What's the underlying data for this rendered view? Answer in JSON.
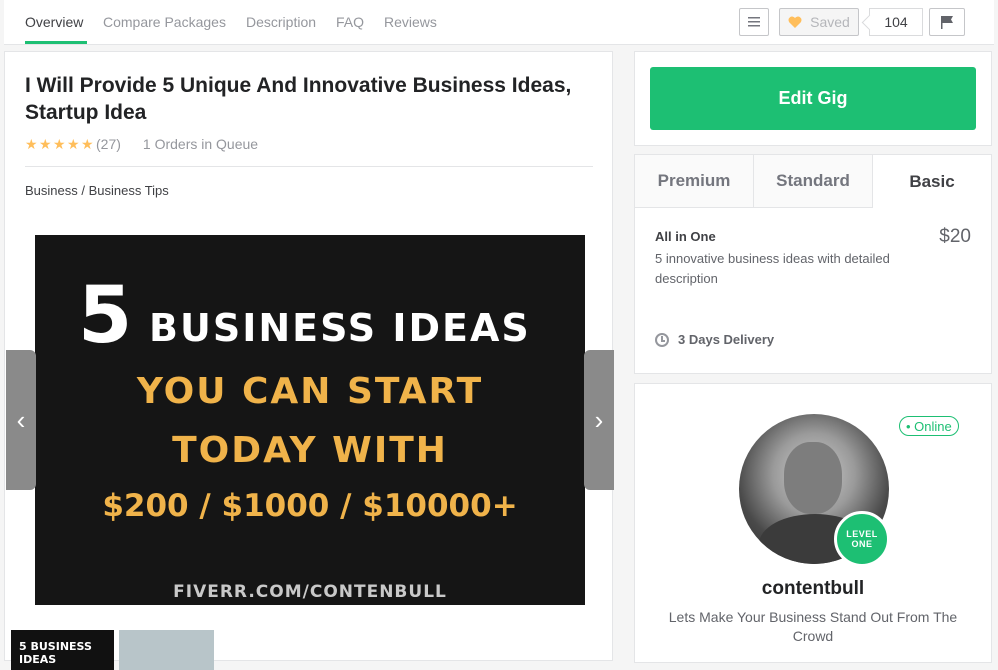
{
  "nav": {
    "tabs": [
      {
        "label": "Overview"
      },
      {
        "label": "Compare Packages"
      },
      {
        "label": "Description"
      },
      {
        "label": "FAQ"
      },
      {
        "label": "Reviews"
      }
    ],
    "saved_label": "Saved",
    "saved_count": "104"
  },
  "gig": {
    "title": "I Will Provide 5 Unique And Innovative Business Ideas, Startup Idea",
    "rating_count": "(27)",
    "queue": "1 Orders in Queue",
    "breadcrumb": "Business / Business Tips",
    "image": {
      "big_number": "5",
      "line1": "BUSINESS IDEAS",
      "line2": "YOU CAN START",
      "line3": "TODAY WITH",
      "line4": "$200 / $1000 / $10000+",
      "footer": "FIVERR.COM/CONTENBULL"
    },
    "thumb1_text": "5 BUSINESS IDEAS"
  },
  "sidebar": {
    "edit_label": "Edit Gig",
    "package_tabs": [
      {
        "label": "Premium"
      },
      {
        "label": "Standard"
      },
      {
        "label": "Basic"
      }
    ],
    "package": {
      "name": "All in One",
      "price": "$20",
      "description": "5 innovative business ideas with detailed description",
      "delivery": "3 Days Delivery"
    },
    "seller": {
      "online": "• Online",
      "level_line1": "LEVEL",
      "level_line2": "ONE",
      "name": "contentbull",
      "tagline": "Lets Make Your Business Stand Out From The Crowd"
    }
  },
  "colors": {
    "accent": "#1dbf73",
    "star": "#ffbe5b",
    "image_highlight": "#f0b34a"
  }
}
